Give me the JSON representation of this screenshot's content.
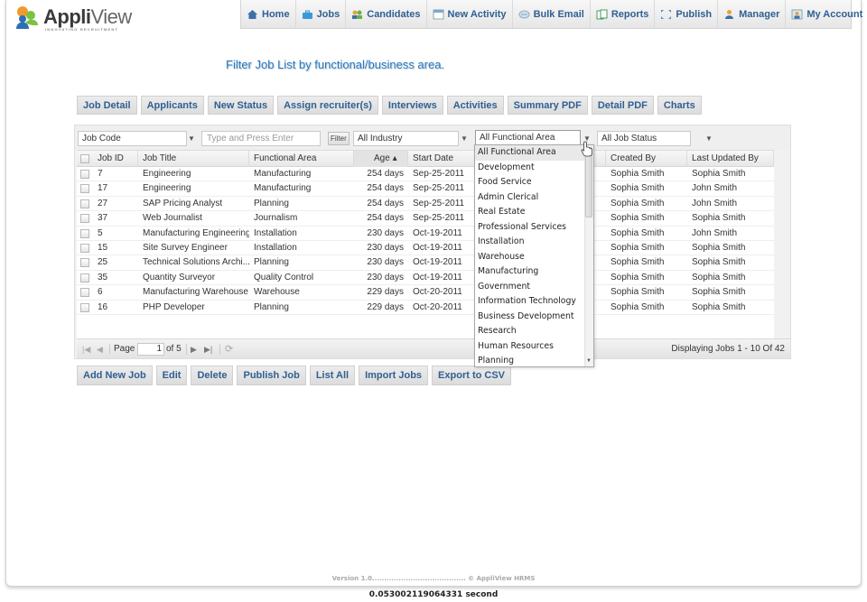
{
  "brand": {
    "name_bold": "Appli",
    "name_light": "View",
    "tagline": "INNOVATING RECRUITMENT"
  },
  "nav": {
    "items": [
      {
        "label": "Home",
        "icon": "home-icon"
      },
      {
        "label": "Jobs",
        "icon": "briefcase-icon"
      },
      {
        "label": "Candidates",
        "icon": "people-icon"
      },
      {
        "label": "New Activity",
        "icon": "calendar-icon"
      },
      {
        "label": "Bulk Email",
        "icon": "email-icon"
      },
      {
        "label": "Reports",
        "icon": "reports-icon"
      },
      {
        "label": "Publish",
        "icon": "publish-icon"
      },
      {
        "label": "Manager",
        "icon": "manager-icon"
      },
      {
        "label": "My Account",
        "icon": "account-icon"
      }
    ]
  },
  "instruction": "Filter Job List by functional/business area.",
  "tabs": [
    "Job Detail",
    "Applicants",
    "New Status",
    "Assign recruiter(s)",
    "Interviews",
    "Activities",
    "Summary PDF",
    "Detail PDF",
    "Charts"
  ],
  "filters": {
    "field_select": "Job Code",
    "search_placeholder": "Type and Press Enter",
    "filter_button": "Filter",
    "industry_select": "All Industry",
    "functional_area_select": "All Functional Area",
    "job_status_select": "All Job Status"
  },
  "table": {
    "columns": [
      "Job ID",
      "Job Title",
      "Functional Area",
      "Age ▴",
      "Start Date",
      "Created By",
      "Last Updated By"
    ],
    "rows": [
      {
        "id": "7",
        "title": "Engineering",
        "area": "Manufacturing",
        "age": "254 days",
        "start": "Sep-25-2011",
        "created": "Sophia Smith",
        "updated": "Sophia Smith"
      },
      {
        "id": "17",
        "title": "Engineering",
        "area": "Manufacturing",
        "age": "254 days",
        "start": "Sep-25-2011",
        "created": "Sophia Smith",
        "updated": "John Smith"
      },
      {
        "id": "27",
        "title": "SAP Pricing Analyst",
        "area": "Planning",
        "age": "254 days",
        "start": "Sep-25-2011",
        "created": "Sophia Smith",
        "updated": "John Smith"
      },
      {
        "id": "37",
        "title": "Web Journalist",
        "area": "Journalism",
        "age": "254 days",
        "start": "Sep-25-2011",
        "created": "Sophia Smith",
        "updated": "Sophia Smith"
      },
      {
        "id": "5",
        "title": "Manufacturing Engineering",
        "area": "Installation",
        "age": "230 days",
        "start": "Oct-19-2011",
        "created": "Sophia Smith",
        "updated": "John Smith"
      },
      {
        "id": "15",
        "title": "Site Survey Engineer",
        "area": "Installation",
        "age": "230 days",
        "start": "Oct-19-2011",
        "created": "Sophia Smith",
        "updated": "Sophia Smith"
      },
      {
        "id": "25",
        "title": "Technical Solutions Archi...",
        "area": "Planning",
        "age": "230 days",
        "start": "Oct-19-2011",
        "created": "Sophia Smith",
        "updated": "Sophia Smith"
      },
      {
        "id": "35",
        "title": "Quantity Surveyor",
        "area": "Quality Control",
        "age": "230 days",
        "start": "Oct-19-2011",
        "created": "Sophia Smith",
        "updated": "Sophia Smith"
      },
      {
        "id": "6",
        "title": "Manufacturing Warehouse",
        "area": "Warehouse",
        "age": "229 days",
        "start": "Oct-20-2011",
        "created": "Sophia Smith",
        "updated": "Sophia Smith"
      },
      {
        "id": "16",
        "title": "PHP Developer",
        "area": "Planning",
        "age": "229 days",
        "start": "Oct-20-2011",
        "created": "Sophia Smith",
        "updated": "Sophia Smith"
      }
    ]
  },
  "pager": {
    "page_label": "Page",
    "page_value": "1",
    "of_label": "of 5",
    "display_text": "Displaying Jobs 1 - 10 Of 42"
  },
  "actions": [
    "Add New Job",
    "Edit",
    "Delete",
    "Publish Job",
    "List All",
    "Import Jobs",
    "Export to CSV"
  ],
  "dropdown": {
    "options": [
      "All Functional Area",
      "Development",
      "Food Service",
      "Admin Clerical",
      "Real Estate",
      "Professional Services",
      "Installation",
      "Warehouse",
      "Manufacturing",
      "Government",
      "Information Technology",
      "Business Development",
      "Research",
      "Human Resources",
      "Planning"
    ],
    "selected": "All Functional Area"
  },
  "footer": {
    "version": "Version 1.0....................................... © AppliView HRMS",
    "timing": "0.053002119064331 second"
  },
  "colors": {
    "accent_blue": "#2f5f92",
    "instruction_blue": "#1f78c8"
  }
}
